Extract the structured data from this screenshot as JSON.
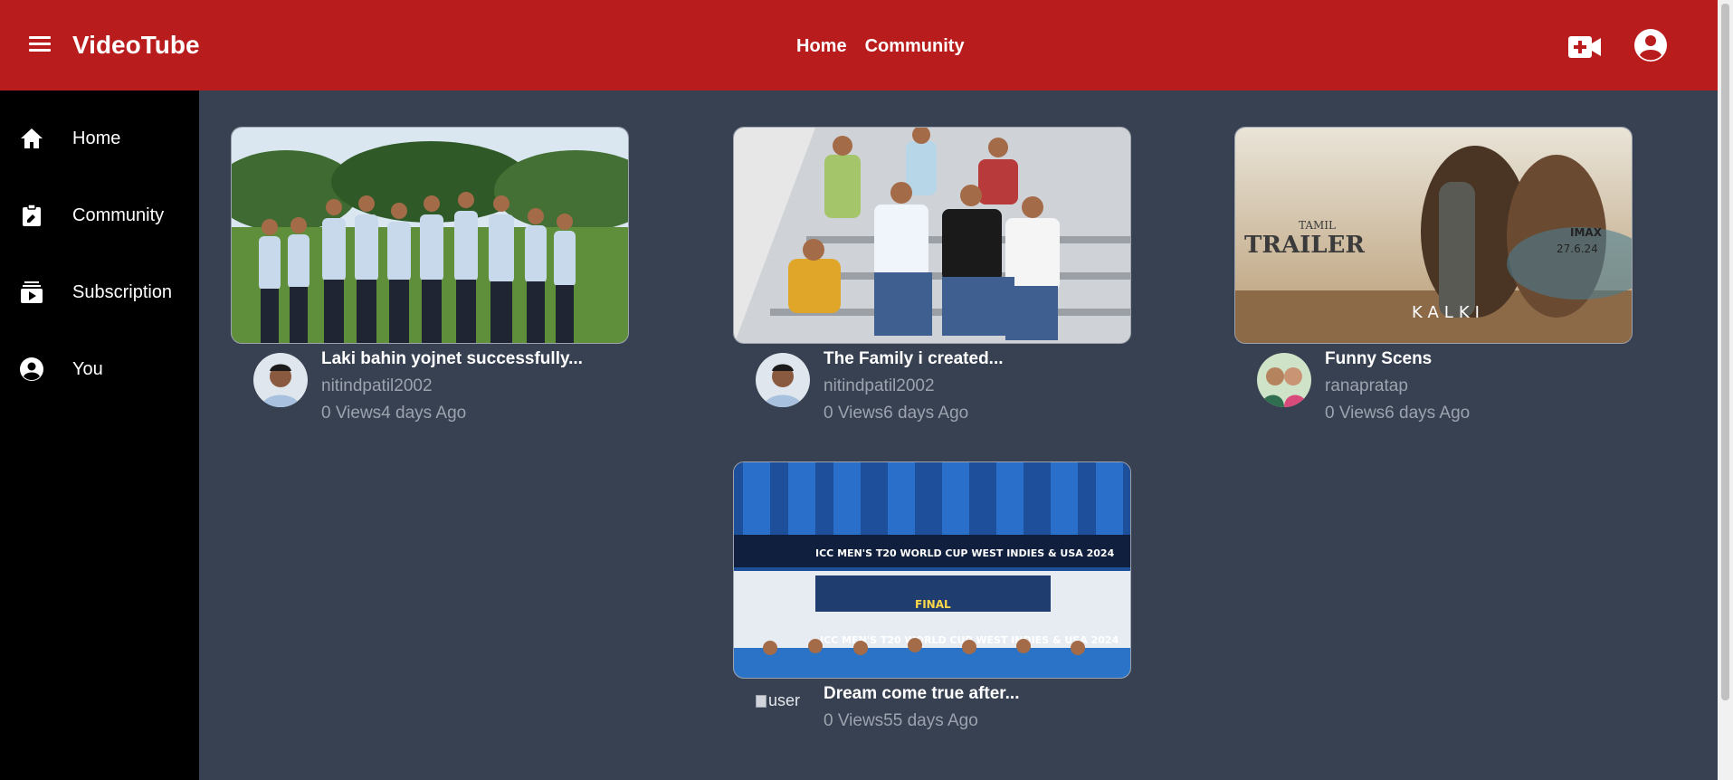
{
  "header": {
    "brand": "VideoTube",
    "nav": [
      "Home",
      "Community"
    ]
  },
  "sidebar": {
    "items": [
      {
        "label": "Home",
        "icon": "home-icon"
      },
      {
        "label": "Community",
        "icon": "clipboard-icon"
      },
      {
        "label": "Subscription",
        "icon": "subscription-icon"
      },
      {
        "label": "You",
        "icon": "account-icon"
      }
    ]
  },
  "videos": [
    {
      "title": "Laki bahin yojnet successfully...",
      "channel": "nitindpatil2002",
      "views": "0 Views",
      "age": "4 days Ago",
      "stats": "0 Views4 days Ago"
    },
    {
      "title": "The Family i created...",
      "channel": "nitindpatil2002",
      "views": "0 Views",
      "age": "6 days Ago",
      "stats": "0 Views6 days Ago"
    },
    {
      "title": "Funny Scens",
      "channel": "ranapratap",
      "views": "0 Views",
      "age": "6 days Ago",
      "stats": "0 Views6 days Ago"
    },
    {
      "title": "Dream come true after...",
      "channel": "",
      "views": "0 Views",
      "age": "55 days Ago",
      "stats": "0 Views55 days Ago",
      "avatar_alt": "user"
    }
  ],
  "thumb_text": {
    "kalki_tamil": "TAMIL",
    "kalki_trailer": "TRAILER",
    "kalki_imax": "IMAX",
    "kalki_date": "27.6.24",
    "kalki_name": "KALKI",
    "wc_top": "ICC MEN'S T20 WORLD CUP WEST INDIES & USA 2024",
    "wc_final": "FINAL",
    "wc_bottom": "ICC MEN'S T20 WORLD CUP WEST INDIES & USA 2024"
  },
  "colors": {
    "header": "#b91c1c",
    "sidebar": "#000000",
    "background": "#374151",
    "muted_text": "#9ca3af"
  }
}
